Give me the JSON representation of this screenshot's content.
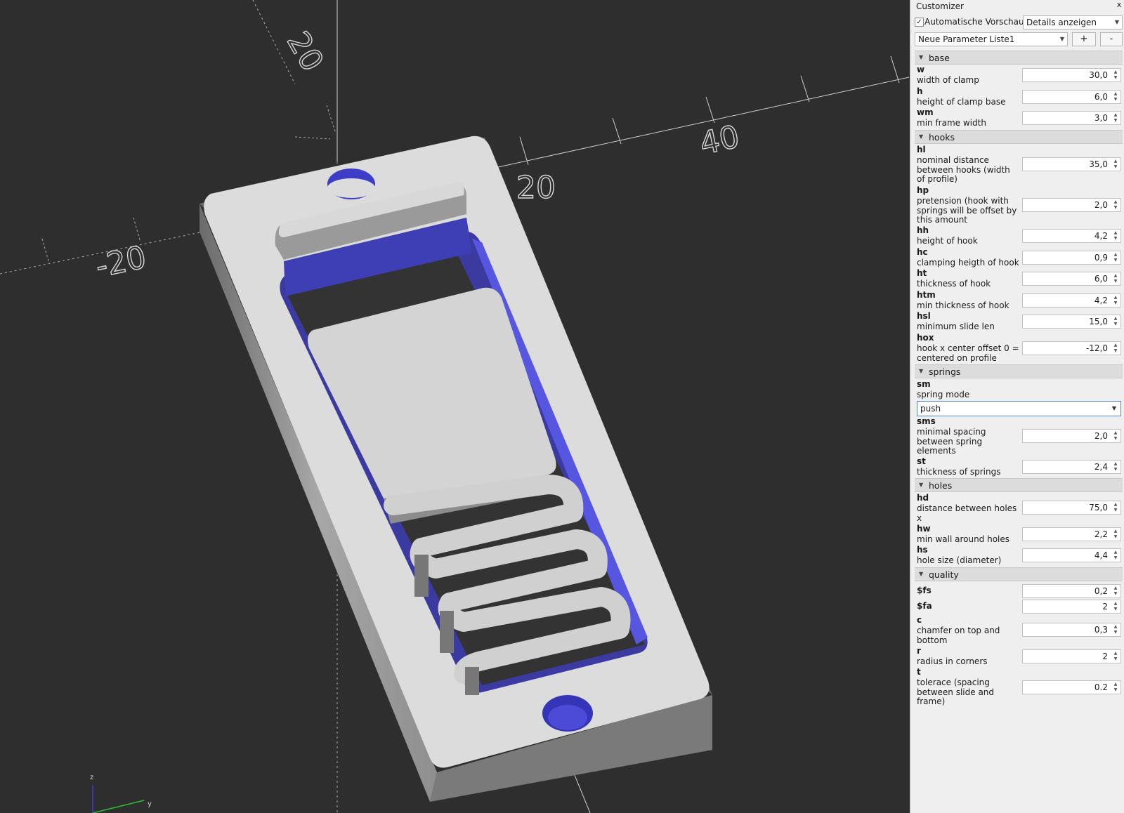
{
  "viewport": {
    "axis_tick_labels": [
      "20",
      "20",
      "40",
      "-20"
    ],
    "mini_axis": {
      "z": "z",
      "y": "y"
    }
  },
  "customizer": {
    "title": "Customizer",
    "close_label": "x",
    "auto_preview_label": "Automatische Vorschau",
    "auto_preview_checked": true,
    "details_combo": "Details anzeigen",
    "param_set_combo": "Neue Parameter Liste1",
    "add_label": "+",
    "remove_label": "-"
  },
  "groups": {
    "base": {
      "name": "base",
      "params": [
        {
          "name": "w",
          "desc": "width of clamp",
          "value": "30,0"
        },
        {
          "name": "h",
          "desc": "height of clamp base",
          "value": "6,0"
        },
        {
          "name": "wm",
          "desc": "min frame width",
          "value": "3,0"
        }
      ]
    },
    "hooks": {
      "name": "hooks",
      "params": [
        {
          "name": "hl",
          "desc": "nominal distance between hooks (width of profile)",
          "value": "35,0"
        },
        {
          "name": "hp",
          "desc": "pretension (hook with springs will be offset by this amount",
          "value": "2,0"
        },
        {
          "name": "hh",
          "desc": "height of hook",
          "value": "4,2"
        },
        {
          "name": "hc",
          "desc": "clamping heigth of hook",
          "value": "0,9"
        },
        {
          "name": "ht",
          "desc": "thickness of hook",
          "value": "6,0"
        },
        {
          "name": "htm",
          "desc": "min thickness of hook",
          "value": "4,2"
        },
        {
          "name": "hsl",
          "desc": "minimum slide len",
          "value": "15,0"
        },
        {
          "name": "hox",
          "desc": "hook x center offset 0 = centered on profile",
          "value": "-12,0"
        }
      ]
    },
    "springs": {
      "name": "springs",
      "sm": {
        "name": "sm",
        "desc": "spring mode",
        "value": "push"
      },
      "params": [
        {
          "name": "sms",
          "desc": "minimal spacing between spring elements",
          "value": "2,0"
        },
        {
          "name": "st",
          "desc": "thickness of springs",
          "value": "2,4"
        }
      ]
    },
    "holes": {
      "name": "holes",
      "params": [
        {
          "name": "hd",
          "desc": "distance between holes x",
          "value": "75,0"
        },
        {
          "name": "hw",
          "desc": "min wall around holes",
          "value": "2,2"
        },
        {
          "name": "hs",
          "desc": "hole size (diameter)",
          "value": "4,4"
        }
      ]
    },
    "quality": {
      "name": "quality",
      "params": [
        {
          "name": "$fs",
          "desc": "",
          "value": "0,2"
        },
        {
          "name": "$fa",
          "desc": "",
          "value": "2"
        },
        {
          "name": "c",
          "desc": "chamfer on top and bottom",
          "value": "0,3"
        },
        {
          "name": "r",
          "desc": "radius in corners",
          "value": "2"
        },
        {
          "name": "t",
          "desc": "tolerace (spacing between slide and frame)",
          "value": "0.2"
        }
      ]
    }
  }
}
